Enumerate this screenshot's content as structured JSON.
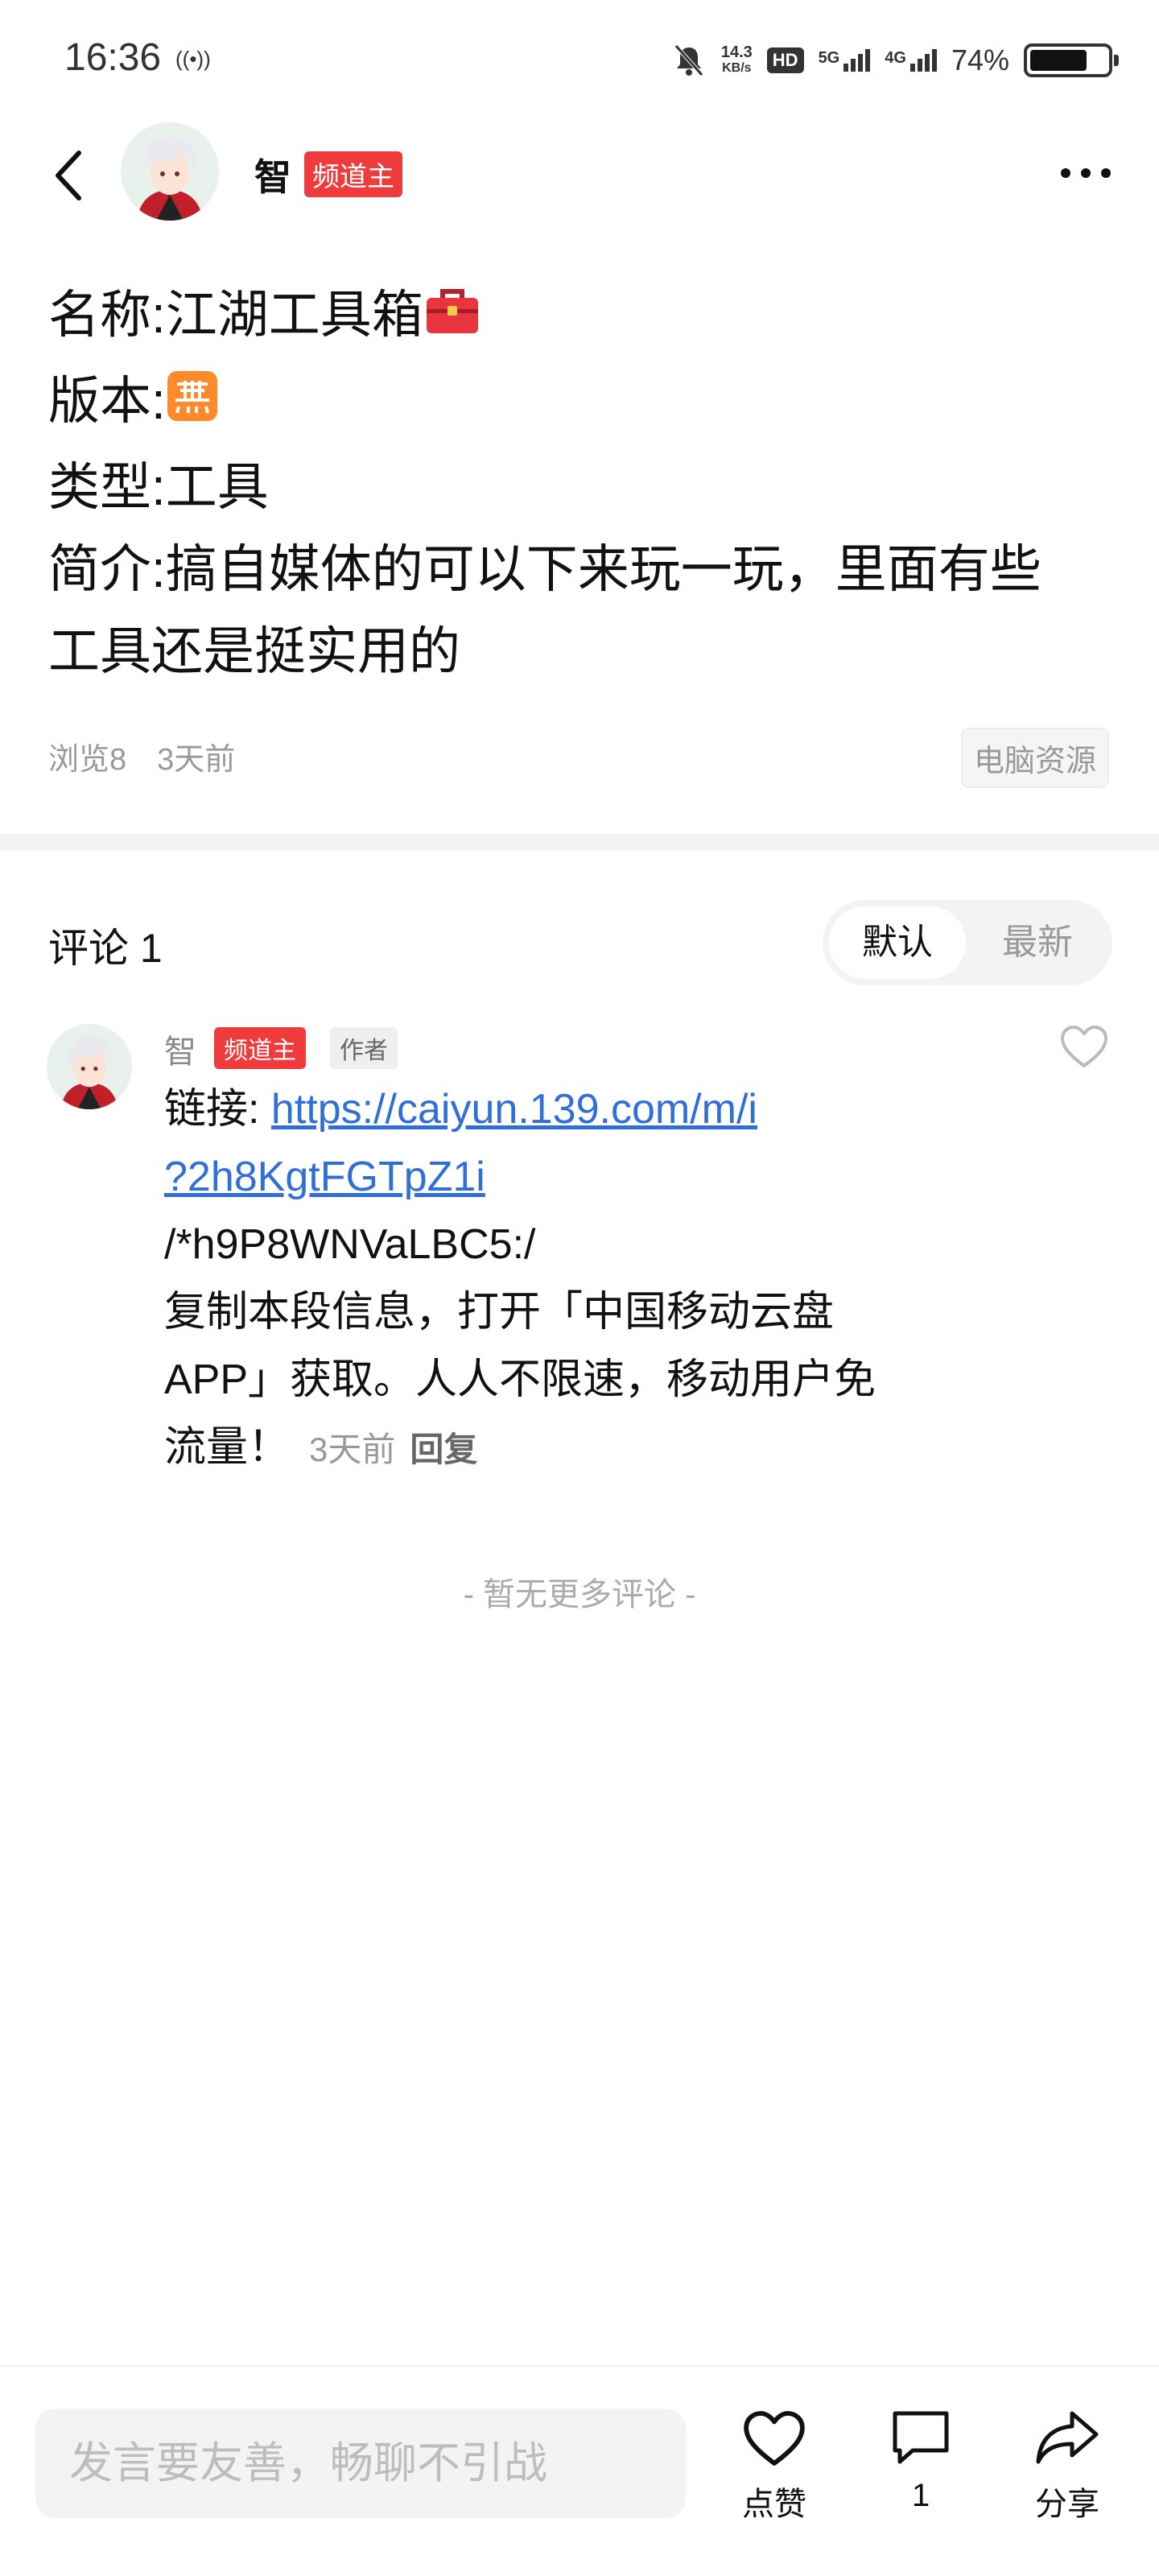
{
  "status_bar": {
    "time": "16:36",
    "net_speed_value": "14.3",
    "net_speed_unit": "KB/s",
    "hd_label": "HD",
    "sim1_label": "5G",
    "sim2_label": "4G",
    "battery_percent": "74%",
    "battery_level": 0.74
  },
  "header": {
    "author_name": "智",
    "author_badge": "频道主"
  },
  "post": {
    "lines": [
      "名称:江湖工具箱",
      "版本:",
      "类型:工具",
      "简介:搞自媒体的可以下来玩一玩，里面有些",
      "工具还是挺实用的"
    ],
    "views": "浏览8",
    "time": "3天前",
    "tag": "电脑资源",
    "icons": [
      "toolbox-emoji",
      "unlimited-emoji"
    ]
  },
  "comments": {
    "title": "评论 1",
    "sort_default": "默认",
    "sort_newest": "最新",
    "items": [
      {
        "author": "智",
        "badge": "频道主",
        "author_tag": "作者",
        "link_label": "链接: ",
        "link_line1": "https://caiyun.139.com/m/i",
        "link_line2": "?2h8KgtFGTpZ1i",
        "code": "/*h9P8WNVaLBC5:/",
        "text1": "复制本段信息，打开「中国移动云盘",
        "text2": "APP」获取。人人不限速，移动用户免",
        "text3": "流量！",
        "time": "3天前",
        "reply": "回复"
      }
    ],
    "no_more": "- 暂无更多评论 -"
  },
  "bottom_bar": {
    "input_placeholder": "发言要友善，畅聊不引战",
    "like_label": "点赞",
    "comment_count": "1",
    "share_label": "分享"
  },
  "colors": {
    "accent_red": "#ef3b3b",
    "link_blue": "#2f6fd6",
    "muted_gray": "#999999"
  }
}
